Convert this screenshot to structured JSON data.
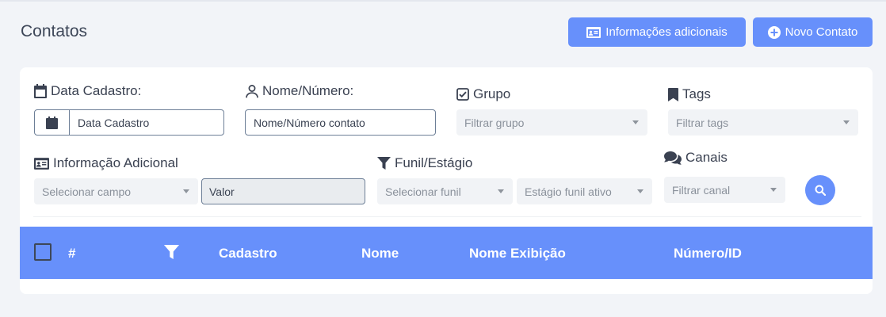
{
  "header": {
    "title": "Contatos",
    "info_button_label": "Informações adicionais",
    "new_contact_button_label": "Novo Contato"
  },
  "filters": {
    "date_label": "Data Cadastro:",
    "date_placeholder": "Data Cadastro",
    "name_label": "Nome/Número:",
    "name_placeholder": "Nome/Número contato",
    "group_label": "Grupo",
    "group_placeholder": "Filtrar grupo",
    "tags_label": "Tags",
    "tags_placeholder": "Filtrar tags",
    "additional_info_label": "Informação Adicional",
    "field_select_placeholder": "Selecionar campo",
    "value_placeholder": "Valor",
    "funnel_label": "Funil/Estágio",
    "funnel_select_placeholder": "Selecionar funil",
    "stage_select_placeholder": "Estágio funil ativo",
    "channels_label": "Canais",
    "channel_placeholder": "Filtrar canal"
  },
  "table": {
    "columns": [
      "#",
      "Cadastro",
      "Nome",
      "Nome Exibição",
      "Número/ID"
    ]
  },
  "icons": {
    "calendar": "calendar-icon",
    "user": "user-icon",
    "check_square": "check-square-icon",
    "bookmark": "bookmark-icon",
    "id_card": "id-card-icon",
    "filter": "filter-icon",
    "comments": "comments-icon",
    "search": "search-icon",
    "plus_circle": "plus-circle-icon"
  },
  "colors": {
    "accent": "#6790fb",
    "background": "#f2f4f8",
    "text": "#3b4353"
  }
}
